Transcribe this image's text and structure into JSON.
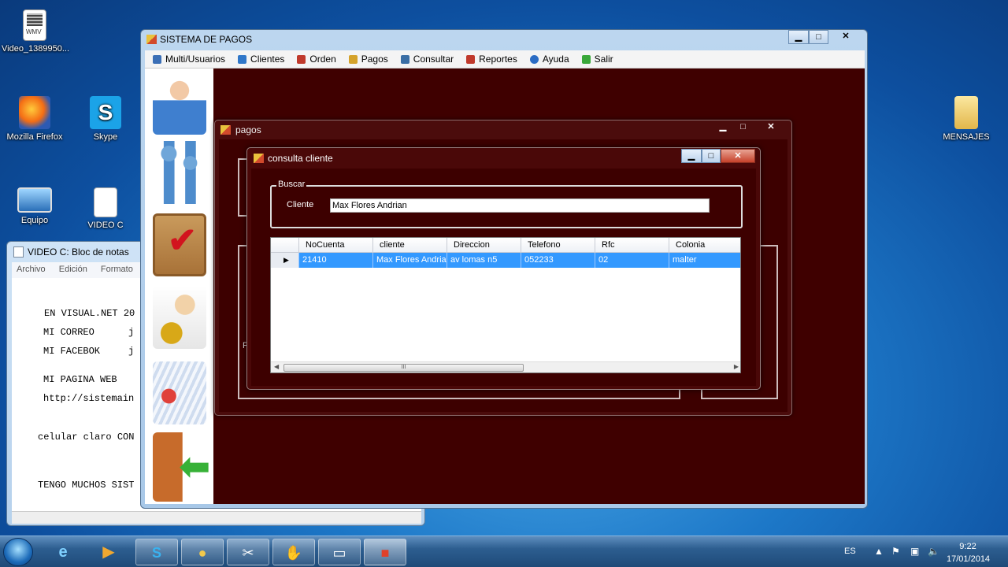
{
  "desktop": {
    "icons": [
      {
        "label": "Video_1389950...",
        "icon": "wmv-file-icon"
      },
      {
        "label": "Mozilla Firefox",
        "icon": "firefox-icon"
      },
      {
        "label": "Skype",
        "icon": "skype-icon"
      },
      {
        "label": "Equipo",
        "icon": "computer-icon"
      },
      {
        "label": "VIDEO C",
        "icon": "text-file-icon"
      },
      {
        "label": "MENSAJES",
        "icon": "folder-icon"
      }
    ],
    "wmv_tag": "WMV"
  },
  "notepad": {
    "title": "VIDEO C: Bloc de notas",
    "menu": [
      "Archivo",
      "Edición",
      "Formato"
    ],
    "lines": [
      "EN VISUAL.NET 20",
      "MI CORREO      j",
      "MI FACEBOK     j",
      "MI PAGINA WEB",
      "http://sistemain",
      "celular claro CON",
      "TENGO MUCHOS SIST"
    ]
  },
  "main_window": {
    "title": "SISTEMA DE PAGOS",
    "menu": [
      {
        "label": "Multi/Usuarios",
        "icon": "users-icon",
        "color": "#3b6fb6"
      },
      {
        "label": "Clientes",
        "icon": "clients-icon",
        "color": "#2f77c9"
      },
      {
        "label": "Orden",
        "icon": "order-icon",
        "color": "#c0392b"
      },
      {
        "label": "Pagos",
        "icon": "payments-icon",
        "color": "#d4a22a"
      },
      {
        "label": "Consultar",
        "icon": "search-icon",
        "color": "#3a6ea5"
      },
      {
        "label": "Reportes",
        "icon": "reports-icon",
        "color": "#c0392b"
      },
      {
        "label": "Ayuda",
        "icon": "help-icon",
        "color": "#2b6cc4"
      },
      {
        "label": "Salir",
        "icon": "exit-icon",
        "color": "#3aa83a"
      }
    ],
    "sidebar": [
      "user-avatar-icon",
      "clients-people-icon",
      "clipboard-check-icon",
      "cashier-payment-icon",
      "chart-report-icon",
      "exit-door-icon"
    ]
  },
  "pagos_window": {
    "title": "pagos",
    "partial_label": "F"
  },
  "consulta_window": {
    "title": "consulta cliente",
    "group_label": "Buscar",
    "field_label": "Cliente",
    "field_value": "Max Flores Andrian",
    "grid": {
      "columns": [
        "NoCuenta",
        "cliente",
        "Direccion",
        "Telefono",
        "Rfc",
        "Colonia"
      ],
      "rows": [
        [
          "21410",
          "Max Flores Andrian",
          "av lomas n5",
          "052233",
          "02",
          "malter"
        ]
      ],
      "scroll_thumb": "III"
    }
  },
  "window_buttons": {
    "minimize": "▁",
    "maximize": "□",
    "close": "✕"
  },
  "taskbar": {
    "language": "ES",
    "time": "9:22",
    "date": "17/01/2014",
    "pinned": [
      "start-orb-icon",
      "internet-explorer-icon",
      "media-player-icon",
      "skype-icon",
      "paint-icon",
      "snipping-tool-icon",
      "game-icon",
      "notepad-icon",
      "app-icon"
    ]
  },
  "colors": {
    "mdi_background": "#3f0000",
    "selection": "#3399ff"
  }
}
